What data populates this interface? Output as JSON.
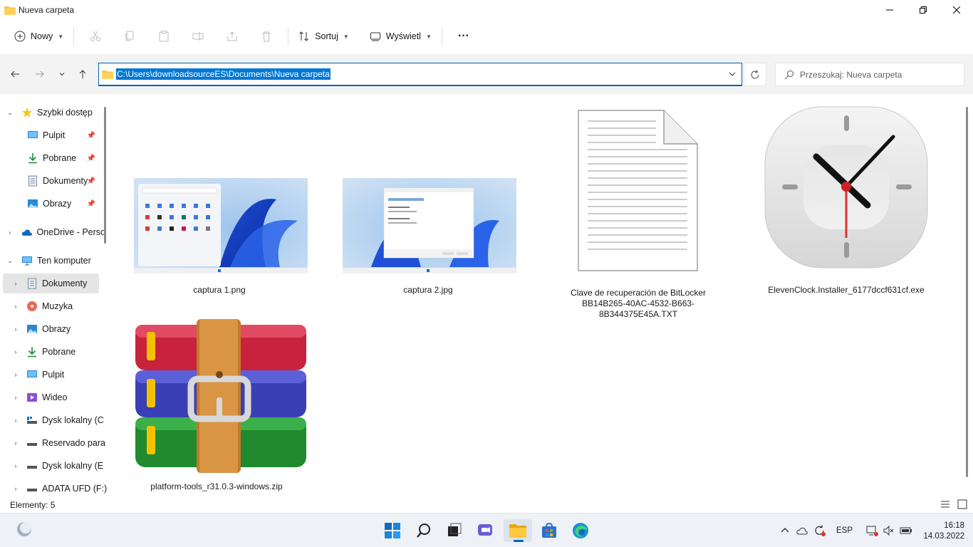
{
  "window": {
    "title": "Nueva carpeta"
  },
  "toolbar": {
    "new_label": "Nowy",
    "sort_label": "Sortuj",
    "view_label": "Wyświetl",
    "more_label": "···"
  },
  "address": {
    "path": "C:\\Users\\downloadsourceES\\Documents\\Nueva carpeta",
    "search_placeholder": "Przeszukaj: Nueva carpeta"
  },
  "sidebar": {
    "items": [
      {
        "label": "Szybki dostęp",
        "icon": "star-icon"
      },
      {
        "label": "Pulpit",
        "icon": "desktop-icon"
      },
      {
        "label": "Pobrane",
        "icon": "download-icon"
      },
      {
        "label": "Dokumenty",
        "icon": "document-icon"
      },
      {
        "label": "Obrazy",
        "icon": "pictures-icon"
      },
      {
        "label": "OneDrive - Perso",
        "icon": "cloud-icon"
      },
      {
        "label": "Ten komputer",
        "icon": "computer-icon"
      },
      {
        "label": "Dokumenty",
        "icon": "document-icon"
      },
      {
        "label": "Muzyka",
        "icon": "music-icon"
      },
      {
        "label": "Obrazy",
        "icon": "pictures-icon"
      },
      {
        "label": "Pobrane",
        "icon": "download-icon"
      },
      {
        "label": "Pulpit",
        "icon": "desktop-icon"
      },
      {
        "label": "Wideo",
        "icon": "video-icon"
      },
      {
        "label": "Dysk lokalny (C",
        "icon": "drive-icon"
      },
      {
        "label": "Reservado para",
        "icon": "drive-icon"
      },
      {
        "label": "Dysk lokalny (E",
        "icon": "drive-icon"
      },
      {
        "label": "ADATA UFD (F:)",
        "icon": "usb-drive-icon"
      }
    ]
  },
  "files": [
    {
      "name": "captura 1.png"
    },
    {
      "name": "captura 2.jpg"
    },
    {
      "name": "Clave de recuperación de BitLocker BB14B265-40AC-4532-B663-8B344375E45A.TXT"
    },
    {
      "name": "ElevenClock.Installer_6177dccf631cf.exe"
    },
    {
      "name": "platform-tools_r31.0.3-windows.zip"
    }
  ],
  "status": {
    "count": "Elementy: 5"
  },
  "taskbar": {
    "lang": "ESP",
    "time": "16:18",
    "date": "14.03.2022"
  },
  "colors": {
    "accent": "#0078d4",
    "folder": "#f4c542"
  }
}
